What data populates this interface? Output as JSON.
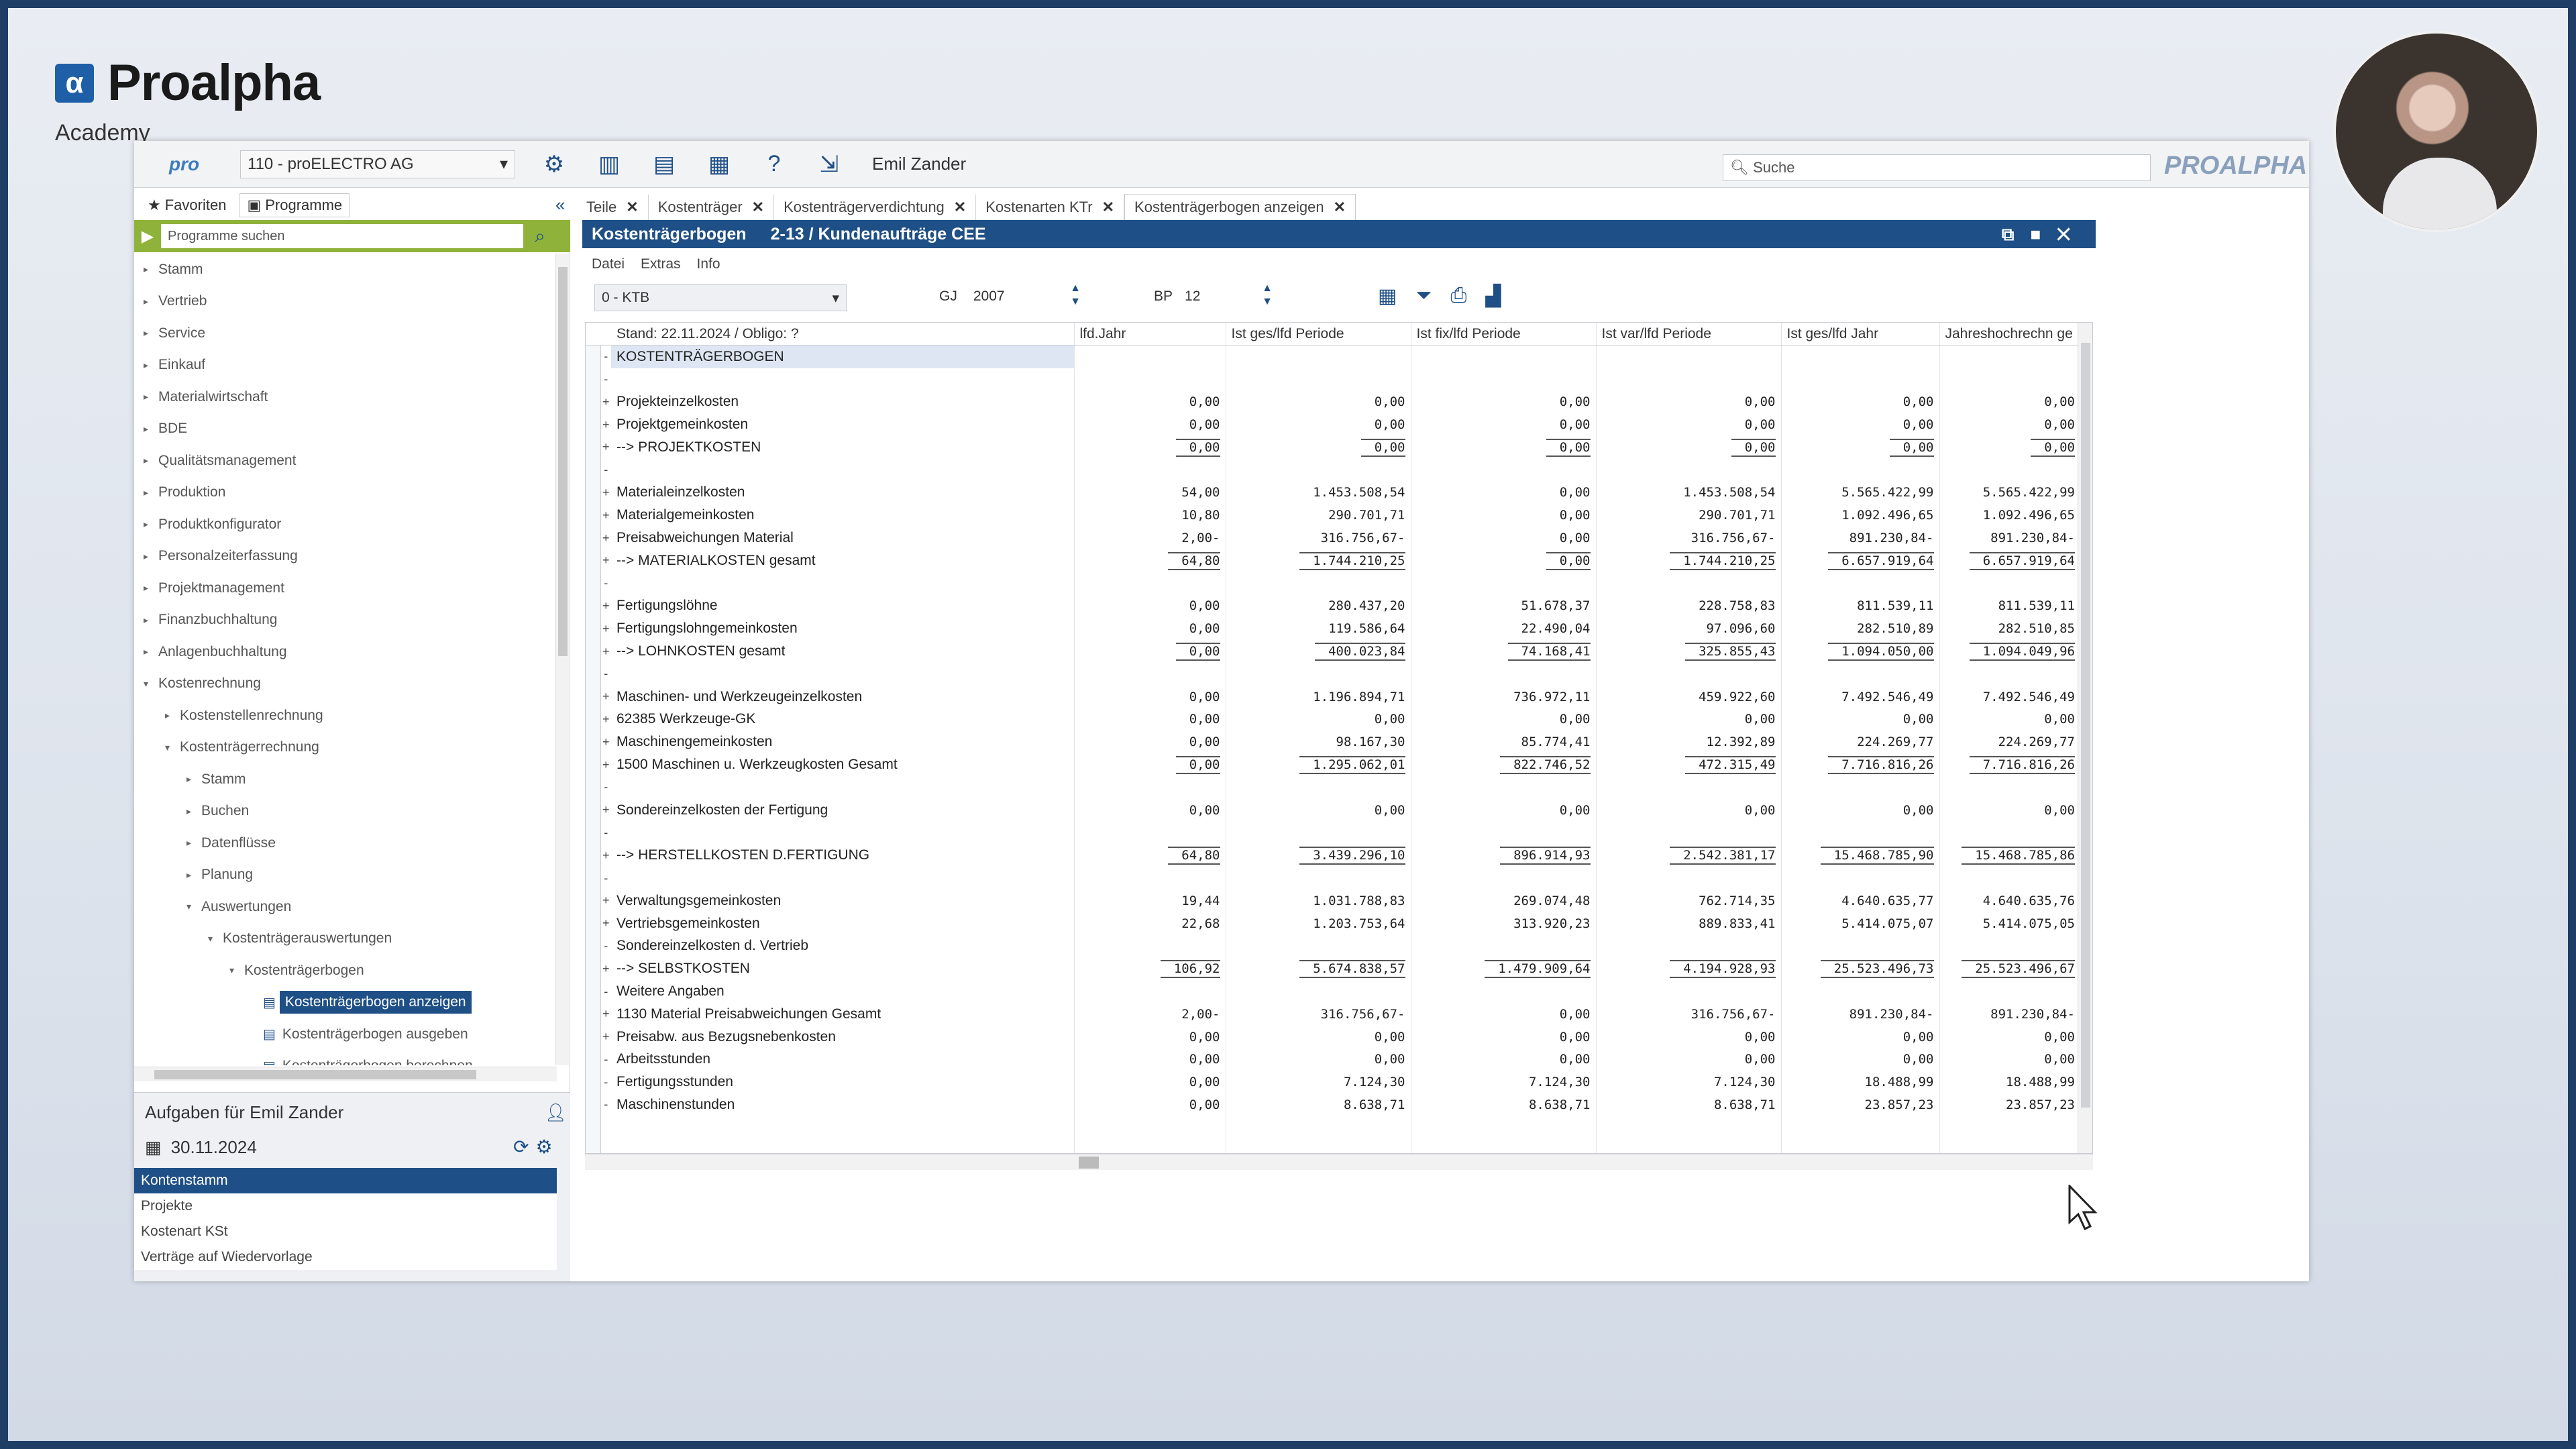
{
  "brand": {
    "name": "Proalpha",
    "subtitle": "Academy",
    "logo_letter": "α"
  },
  "topbar": {
    "pro_logo": "pro",
    "company": "110 - proELECTRO AG",
    "user": "Emil Zander",
    "search_placeholder": "Suche",
    "logo_right": "PROALPHA"
  },
  "left_tabs": {
    "favoriten": "Favoriten",
    "programme": "Programme"
  },
  "doc_tabs": [
    "Teile",
    "Kostenträger",
    "Kostenträgerverdichtung",
    "Kostenarten KTr",
    "Kostenträgerbogen anzeigen"
  ],
  "sidebar": {
    "search_placeholder": "Programme suchen",
    "tree": [
      {
        "label": "Stamm",
        "level": 0,
        "arrow": "▸"
      },
      {
        "label": "Vertrieb",
        "level": 0,
        "arrow": "▸"
      },
      {
        "label": "Service",
        "level": 0,
        "arrow": "▸"
      },
      {
        "label": "Einkauf",
        "level": 0,
        "arrow": "▸"
      },
      {
        "label": "Materialwirtschaft",
        "level": 0,
        "arrow": "▸"
      },
      {
        "label": "BDE",
        "level": 0,
        "arrow": "▸"
      },
      {
        "label": "Qualitätsmanagement",
        "level": 0,
        "arrow": "▸"
      },
      {
        "label": "Produktion",
        "level": 0,
        "arrow": "▸"
      },
      {
        "label": "Produktkonfigurator",
        "level": 0,
        "arrow": "▸"
      },
      {
        "label": "Personalzeiterfassung",
        "level": 0,
        "arrow": "▸"
      },
      {
        "label": "Projektmanagement",
        "level": 0,
        "arrow": "▸"
      },
      {
        "label": "Finanzbuchhaltung",
        "level": 0,
        "arrow": "▸"
      },
      {
        "label": "Anlagenbuchhaltung",
        "level": 0,
        "arrow": "▸"
      },
      {
        "label": "Kostenrechnung",
        "level": 0,
        "arrow": "▾"
      },
      {
        "label": "Kostenstellenrechnung",
        "level": 1,
        "arrow": "▸"
      },
      {
        "label": "Kostenträgerrechnung",
        "level": 1,
        "arrow": "▾"
      },
      {
        "label": "Stamm",
        "level": 2,
        "arrow": "▸"
      },
      {
        "label": "Buchen",
        "level": 2,
        "arrow": "▸"
      },
      {
        "label": "Datenflüsse",
        "level": 2,
        "arrow": "▸"
      },
      {
        "label": "Planung",
        "level": 2,
        "arrow": "▸"
      },
      {
        "label": "Auswertungen",
        "level": 2,
        "arrow": "▾"
      },
      {
        "label": "Kostenträgerauswertungen",
        "level": 3,
        "arrow": "▾"
      },
      {
        "label": "Kostenträgerbogen",
        "level": 4,
        "arrow": "▾"
      },
      {
        "label": "Kostenträgerbogen anzeigen",
        "level": 5,
        "arrow": "",
        "doc": true,
        "selected": true
      },
      {
        "label": "Kostenträgerbogen ausgeben",
        "level": 5,
        "arrow": "",
        "doc": true
      },
      {
        "label": "Kostenträgerbogen berechnen",
        "level": 5,
        "arrow": "",
        "doc": true
      }
    ]
  },
  "tasks": {
    "title": "Aufgaben für Emil Zander",
    "date": "30.11.2024",
    "items": [
      "Kontenstamm",
      "Projekte",
      "Kostenart KSt",
      "Verträge auf Wiedervorlage"
    ]
  },
  "main": {
    "title": "Kostenträgerbogen",
    "subtitle": "2-13 / Kundenaufträge CEE",
    "menu": [
      "Datei",
      "Extras",
      "Info"
    ],
    "ktb_value": "0 - KTB",
    "gj_label": "GJ",
    "gj_value": "2007",
    "bp_label": "BP",
    "bp_value": "12",
    "columns": [
      "Stand: 22.11.2024 / Obligo: ?",
      "lfd.Jahr",
      "Ist ges/lfd Periode",
      "Ist fix/lfd Periode",
      "Ist var/lfd Periode",
      "Ist ges/lfd Jahr",
      "Jahreshochrechn ge"
    ],
    "rows": [
      {
        "ex": "-",
        "label": "KOSTENTRÄGERBOGEN",
        "v": [
          "",
          "",
          "",
          "",
          "",
          ""
        ],
        "hl": true
      },
      {
        "ex": "-",
        "label": "",
        "v": [
          "",
          "",
          "",
          "",
          "",
          ""
        ]
      },
      {
        "ex": "+",
        "label": "Projekteinzelkosten",
        "v": [
          "0,00",
          "0,00",
          "0,00",
          "0,00",
          "0,00",
          "0,00"
        ]
      },
      {
        "ex": "+",
        "label": "Projektgemeinkosten",
        "v": [
          "0,00",
          "0,00",
          "0,00",
          "0,00",
          "0,00",
          "0,00"
        ]
      },
      {
        "ex": "+",
        "label": "--> PROJEKTKOSTEN",
        "v": [
          "0,00",
          "0,00",
          "0,00",
          "0,00",
          "0,00",
          "0,00"
        ],
        "total": true
      },
      {
        "ex": "-",
        "label": "",
        "v": [
          "",
          "",
          "",
          "",
          "",
          ""
        ]
      },
      {
        "ex": "+",
        "label": "Materialeinzelkosten",
        "v": [
          "54,00",
          "1.453.508,54",
          "0,00",
          "1.453.508,54",
          "5.565.422,99",
          "5.565.422,99"
        ]
      },
      {
        "ex": "+",
        "label": "Materialgemeinkosten",
        "v": [
          "10,80",
          "290.701,71",
          "0,00",
          "290.701,71",
          "1.092.496,65",
          "1.092.496,65"
        ]
      },
      {
        "ex": "+",
        "label": "Preisabweichungen Material",
        "v": [
          "2,00-",
          "316.756,67-",
          "0,00",
          "316.756,67-",
          "891.230,84-",
          "891.230,84-"
        ]
      },
      {
        "ex": "+",
        "label": "--> MATERIALKOSTEN gesamt",
        "v": [
          "64,80",
          "1.744.210,25",
          "0,00",
          "1.744.210,25",
          "6.657.919,64",
          "6.657.919,64"
        ],
        "total": true
      },
      {
        "ex": "-",
        "label": "",
        "v": [
          "",
          "",
          "",
          "",
          "",
          ""
        ]
      },
      {
        "ex": "+",
        "label": "Fertigungslöhne",
        "v": [
          "0,00",
          "280.437,20",
          "51.678,37",
          "228.758,83",
          "811.539,11",
          "811.539,11"
        ]
      },
      {
        "ex": "+",
        "label": "Fertigungslohngemeinkosten",
        "v": [
          "0,00",
          "119.586,64",
          "22.490,04",
          "97.096,60",
          "282.510,89",
          "282.510,85"
        ]
      },
      {
        "ex": "+",
        "label": "--> LOHNKOSTEN gesamt",
        "v": [
          "0,00",
          "400.023,84",
          "74.168,41",
          "325.855,43",
          "1.094.050,00",
          "1.094.049,96"
        ],
        "total": true
      },
      {
        "ex": "-",
        "label": "",
        "v": [
          "",
          "",
          "",
          "",
          "",
          ""
        ]
      },
      {
        "ex": "+",
        "label": "Maschinen- und Werkzeugeinzelkosten",
        "v": [
          "0,00",
          "1.196.894,71",
          "736.972,11",
          "459.922,60",
          "7.492.546,49",
          "7.492.546,49"
        ]
      },
      {
        "ex": "+",
        "label": "   62385 Werkzeuge-GK",
        "v": [
          "0,00",
          "0,00",
          "0,00",
          "0,00",
          "0,00",
          "0,00"
        ]
      },
      {
        "ex": "+",
        "label": "Maschinengemeinkosten",
        "v": [
          "0,00",
          "98.167,30",
          "85.774,41",
          "12.392,89",
          "224.269,77",
          "224.269,77"
        ]
      },
      {
        "ex": "+",
        "label": "   1500 Maschinen u. Werkzeugkosten Gesamt",
        "v": [
          "0,00",
          "1.295.062,01",
          "822.746,52",
          "472.315,49",
          "7.716.816,26",
          "7.716.816,26"
        ],
        "total": true
      },
      {
        "ex": "-",
        "label": "",
        "v": [
          "",
          "",
          "",
          "",
          "",
          ""
        ]
      },
      {
        "ex": "+",
        "label": "Sondereinzelkosten der Fertigung",
        "v": [
          "0,00",
          "0,00",
          "0,00",
          "0,00",
          "0,00",
          "0,00"
        ]
      },
      {
        "ex": "-",
        "label": "",
        "v": [
          "",
          "",
          "",
          "",
          "",
          ""
        ]
      },
      {
        "ex": "+",
        "label": "--> HERSTELLKOSTEN D.FERTIGUNG",
        "v": [
          "64,80",
          "3.439.296,10",
          "896.914,93",
          "2.542.381,17",
          "15.468.785,90",
          "15.468.785,86"
        ],
        "total": true
      },
      {
        "ex": "-",
        "label": "",
        "v": [
          "",
          "",
          "",
          "",
          "",
          ""
        ]
      },
      {
        "ex": "+",
        "label": "Verwaltungsgemeinkosten",
        "v": [
          "19,44",
          "1.031.788,83",
          "269.074,48",
          "762.714,35",
          "4.640.635,77",
          "4.640.635,76"
        ]
      },
      {
        "ex": "+",
        "label": "Vertriebsgemeinkosten",
        "v": [
          "22,68",
          "1.203.753,64",
          "313.920,23",
          "889.833,41",
          "5.414.075,07",
          "5.414.075,05"
        ]
      },
      {
        "ex": "-",
        "label": "Sondereinzelkosten d. Vertrieb",
        "v": [
          "",
          "",
          "",
          "",
          "",
          ""
        ]
      },
      {
        "ex": "+",
        "label": "--> SELBSTKOSTEN",
        "v": [
          "106,92",
          "5.674.838,57",
          "1.479.909,64",
          "4.194.928,93",
          "25.523.496,73",
          "25.523.496,67"
        ],
        "total": true
      },
      {
        "ex": "-",
        "label": "Weitere Angaben",
        "v": [
          "",
          "",
          "",
          "",
          "",
          ""
        ]
      },
      {
        "ex": "+",
        "label": "   1130 Material Preisabweichungen Gesamt",
        "v": [
          "2,00-",
          "316.756,67-",
          "0,00",
          "316.756,67-",
          "891.230,84-",
          "891.230,84-"
        ]
      },
      {
        "ex": "+",
        "label": "Preisabw. aus Bezugsnebenkosten",
        "v": [
          "0,00",
          "0,00",
          "0,00",
          "0,00",
          "0,00",
          "0,00"
        ]
      },
      {
        "ex": "-",
        "label": "Arbeitsstunden",
        "v": [
          "0,00",
          "0,00",
          "0,00",
          "0,00",
          "0,00",
          "0,00"
        ]
      },
      {
        "ex": "-",
        "label": "Fertigungsstunden",
        "v": [
          "0,00",
          "7.124,30",
          "7.124,30",
          "7.124,30",
          "18.488,99",
          "18.488,99"
        ]
      },
      {
        "ex": "-",
        "label": "Maschinenstunden",
        "v": [
          "0,00",
          "8.638,71",
          "8.638,71",
          "8.638,71",
          "23.857,23",
          "23.857,23"
        ]
      },
      {
        "ex": "",
        "label": "",
        "v": [
          "",
          "",
          "",
          "",
          "",
          ""
        ]
      },
      {
        "ex": "",
        "label": "",
        "v": [
          "",
          "",
          "",
          "",
          "",
          ""
        ]
      }
    ]
  }
}
